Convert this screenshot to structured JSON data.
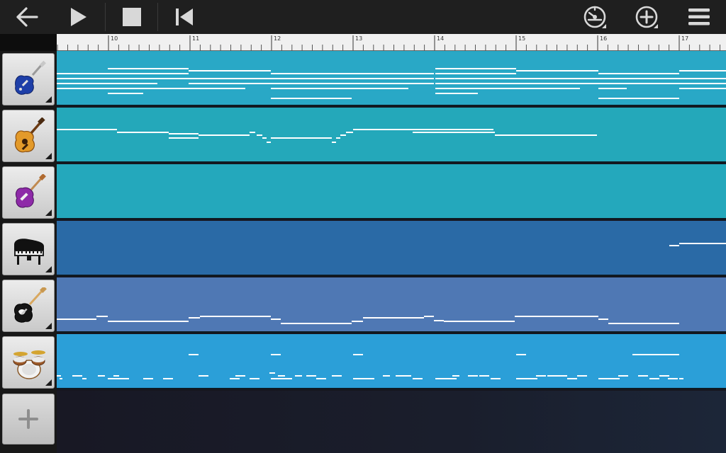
{
  "toolbar": {
    "back_icon": "arrow-left-icon",
    "play_icon": "play-icon",
    "stop_icon": "stop-icon",
    "rewind_icon": "skip-to-start-icon",
    "tempo_icon": "metronome-icon",
    "add_icon": "plus-circle-icon",
    "menu_icon": "menu-icon"
  },
  "ruler": {
    "bars": [
      "10",
      "11",
      "12",
      "13",
      "14",
      "15",
      "16",
      "17"
    ]
  },
  "tracks": [
    {
      "instrument": "electric-guitar-blue",
      "color": "#29a8c6",
      "icon": "guitar-blue-icon"
    },
    {
      "instrument": "acoustic-guitar",
      "color": "#24a8ba",
      "icon": "acoustic-guitar-icon"
    },
    {
      "instrument": "electric-guitar-purple",
      "color": "#24a8bc",
      "icon": "guitar-purple-icon"
    },
    {
      "instrument": "grand-piano",
      "color": "#2a6aa6",
      "icon": "piano-icon"
    },
    {
      "instrument": "bass-guitar",
      "color": "#4f78b4",
      "icon": "bass-guitar-icon"
    },
    {
      "instrument": "drum-kit",
      "color": "#2b9fd8",
      "icon": "drums-icon"
    }
  ],
  "add_track_icon": "plus-icon",
  "colors": {
    "toolbar_bg": "#1f1f1f",
    "icon_fill": "#d8d8d8",
    "note_color": "#ffffff"
  }
}
